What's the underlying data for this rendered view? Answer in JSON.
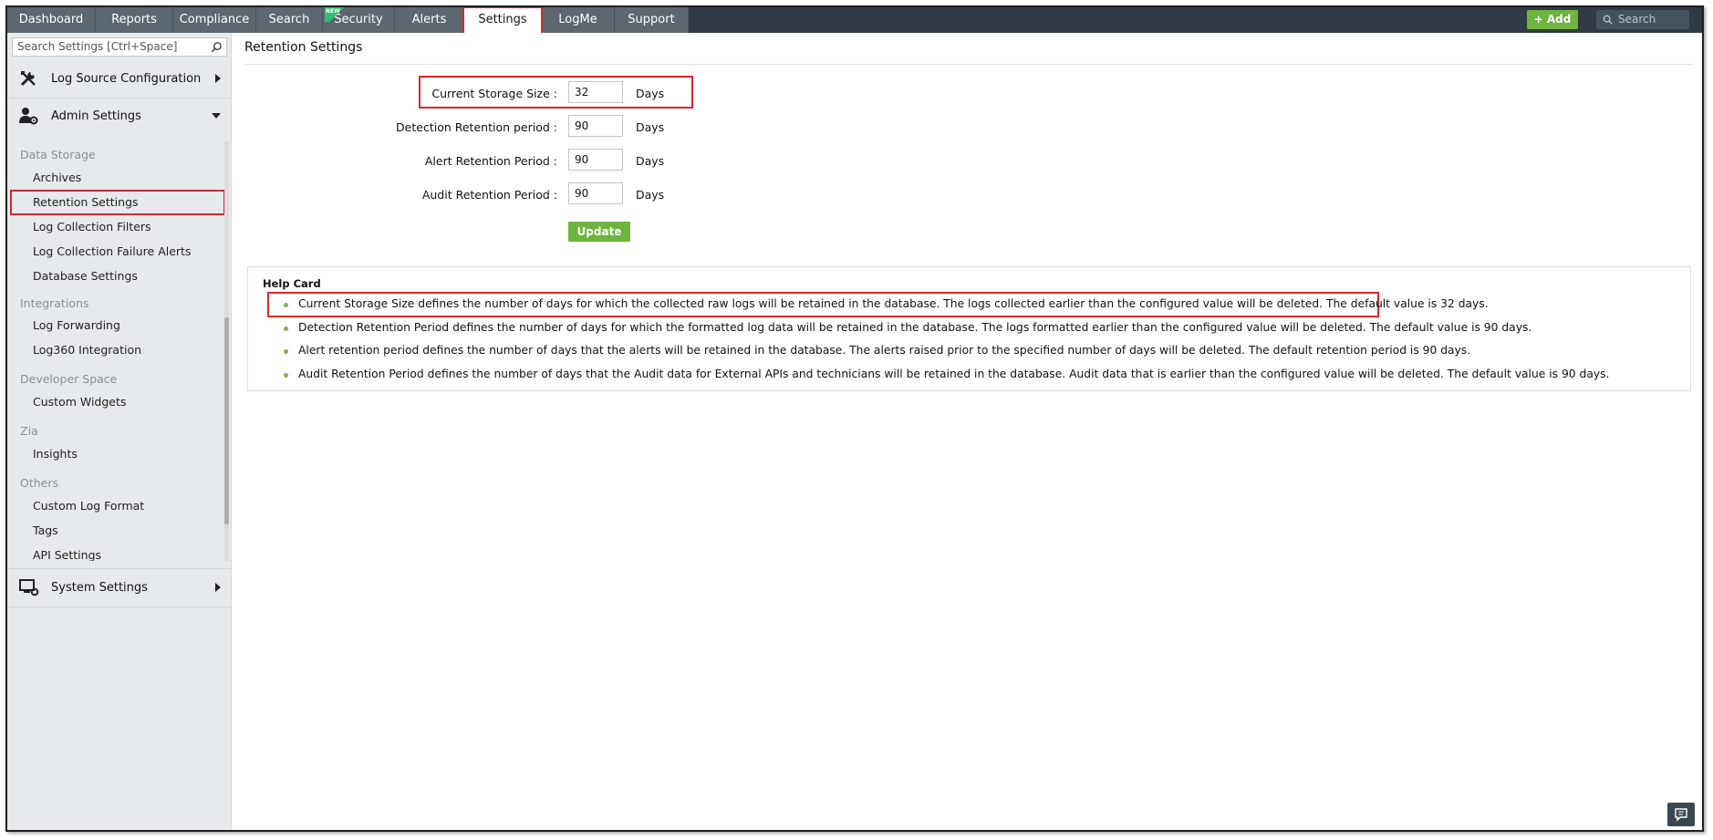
{
  "topnav": {
    "tabs": [
      "Dashboard",
      "Reports",
      "Compliance",
      "Search",
      "Security",
      "Alerts",
      "Settings",
      "LogMe",
      "Support"
    ],
    "new_badge": "NEW",
    "add_label": "+ Add",
    "search_placeholder": "Search"
  },
  "sidebar": {
    "search_placeholder": "Search Settings [Ctrl+Space]",
    "sections": {
      "log_source": "Log Source Configuration",
      "admin": "Admin Settings",
      "system": "System Settings"
    },
    "groups": {
      "data_storage": "Data Storage",
      "integrations": "Integrations",
      "developer_space": "Developer Space",
      "zia": "Zia",
      "others": "Others"
    },
    "items": {
      "archives": "Archives",
      "retention": "Retention Settings",
      "filters": "Log Collection Filters",
      "failure_alerts": "Log Collection Failure Alerts",
      "database": "Database Settings",
      "forwarding": "Log Forwarding",
      "log360": "Log360 Integration",
      "widgets": "Custom Widgets",
      "insights": "Insights",
      "custom_log": "Custom Log Format",
      "tags": "Tags",
      "api": "API Settings"
    }
  },
  "main": {
    "title": "Retention Settings",
    "form": {
      "storage": {
        "label": "Current Storage Size :",
        "value": "32",
        "unit": "Days"
      },
      "detection": {
        "label": "Detection Retention period :",
        "value": "90",
        "unit": "Days"
      },
      "alert": {
        "label": "Alert Retention Period :",
        "value": "90",
        "unit": "Days"
      },
      "audit": {
        "label": "Audit Retention Period :",
        "value": "90",
        "unit": "Days"
      }
    },
    "update_label": "Update",
    "help": {
      "title": "Help Card",
      "items": [
        "Current Storage Size defines the number of days for which the collected raw logs will be retained in the database. The logs collected earlier than the configured value will be deleted. The default value is 32 days.",
        "Detection Retention Period defines the number of days for which the formatted log data will be retained in the database. The logs formatted earlier than the configured value will be deleted. The default value is 90 days.",
        "Alert retention period defines the number of days that the alerts will be retained in the database. The alerts raised prior to the specified number of days will be deleted. The default retention period is 90 days.",
        "Audit Retention Period defines the number of days that the Audit data for External APIs and technicians will be retained in the database. Audit data that is earlier than the configured value will be deleted. The default value is 90 days."
      ]
    }
  },
  "colors": {
    "accent_green": "#6eb43f",
    "highlight_red": "#e0252b",
    "nav_dark": "#2f3a44"
  },
  "icons": [
    "tools-icon",
    "admin-user-gear-icon",
    "monitor-gear-icon",
    "search-icon",
    "chat-icon"
  ]
}
